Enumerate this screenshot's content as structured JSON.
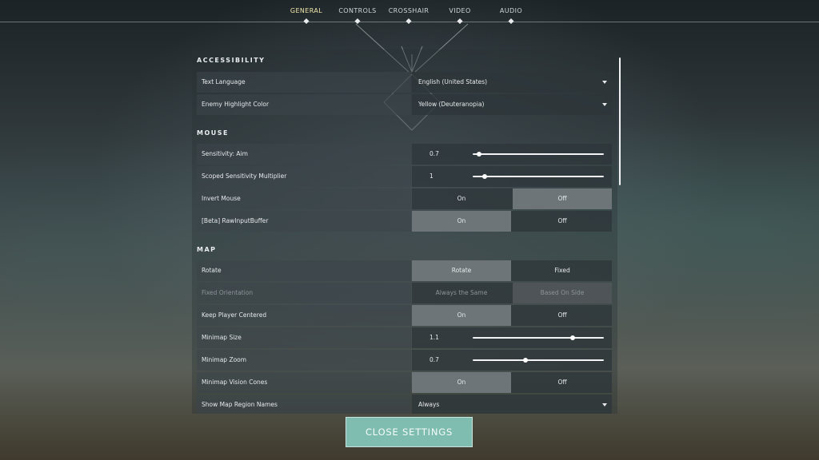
{
  "nav": {
    "tabs": [
      {
        "label": "GENERAL",
        "active": true
      },
      {
        "label": "CONTROLS",
        "active": false
      },
      {
        "label": "CROSSHAIR",
        "active": false
      },
      {
        "label": "VIDEO",
        "active": false
      },
      {
        "label": "AUDIO",
        "active": false
      }
    ]
  },
  "sections": {
    "accessibility": {
      "title": "ACCESSIBILITY",
      "text_language": {
        "label": "Text Language",
        "value": "English (United States)"
      },
      "enemy_highlight": {
        "label": "Enemy Highlight Color",
        "value": "Yellow (Deuteranopia)"
      }
    },
    "mouse": {
      "title": "MOUSE",
      "sensitivity_aim": {
        "label": "Sensitivity: Aim",
        "value": "0.7",
        "fill": 0.05
      },
      "scoped_multiplier": {
        "label": "Scoped Sensitivity Multiplier",
        "value": "1",
        "fill": 0.09
      },
      "invert_mouse": {
        "label": "Invert Mouse",
        "on": "On",
        "off": "Off",
        "selected": "Off"
      },
      "raw_input": {
        "label": "[Beta] RawInputBuffer",
        "on": "On",
        "off": "Off",
        "selected": "On"
      }
    },
    "map": {
      "title": "MAP",
      "rotate": {
        "label": "Rotate",
        "left": "Rotate",
        "right": "Fixed",
        "selected": "Rotate"
      },
      "fixed_orientation": {
        "label": "Fixed Orientation",
        "left": "Always the Same",
        "right": "Based On Side",
        "selected": "Based On Side",
        "disabled": true
      },
      "keep_centered": {
        "label": "Keep Player Centered",
        "on": "On",
        "off": "Off",
        "selected": "On"
      },
      "minimap_size": {
        "label": "Minimap Size",
        "value": "1.1",
        "fill": 0.76
      },
      "minimap_zoom": {
        "label": "Minimap Zoom",
        "value": "0.7",
        "fill": 0.4
      },
      "vision_cones": {
        "label": "Minimap Vision Cones",
        "on": "On",
        "off": "Off",
        "selected": "On"
      },
      "region_names": {
        "label": "Show Map Region Names",
        "value": "Always"
      }
    }
  },
  "close_button": {
    "label": "CLOSE SETTINGS"
  },
  "colors": {
    "accent": "#7fbdb0",
    "active_tab": "#efe6a8"
  }
}
